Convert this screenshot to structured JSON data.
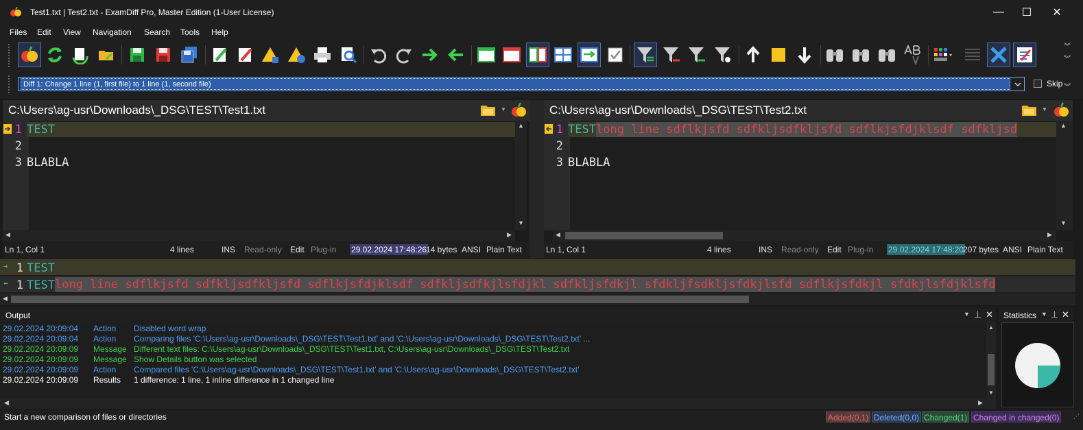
{
  "window": {
    "title": "Test1.txt  |  Test2.txt - ExamDiff Pro, Master Edition (1-User License)"
  },
  "menu": [
    "Files",
    "Edit",
    "View",
    "Navigation",
    "Search",
    "Tools",
    "Help"
  ],
  "diff_selector": {
    "value": "Diff 1: Change 1 line (1, first file) to 1 line (1, second file)"
  },
  "skip_label": "Skip",
  "left": {
    "path": "C:\\Users\\ag-usr\\Downloads\\_DSG\\TEST\\Test1.txt",
    "lines": [
      {
        "num": "1",
        "pre": "TEST",
        "post": ""
      },
      {
        "num": "2",
        "pre": "",
        "post": ""
      },
      {
        "num": "3",
        "pre": "BLABLA",
        "post": ""
      }
    ],
    "status": {
      "pos": "Ln 1, Col 1",
      "lines": "4 lines",
      "ins": "INS",
      "ro": "Read-only",
      "edit": "Edit",
      "plugin": "Plug-in",
      "date": "29.02.2024 17:48:26",
      "size": "14 bytes",
      "enc": "ANSI",
      "type": "Plain Text"
    }
  },
  "right": {
    "path": "C:\\Users\\ag-usr\\Downloads\\_DSG\\TEST\\Test2.txt",
    "lines": [
      {
        "num": "1",
        "pre": "TEST",
        "post": " long line sdflkjsfd sdfkljsdfkljsfd sdflkjsfdjklsdf sdfkljsd"
      },
      {
        "num": "2",
        "pre": "",
        "post": ""
      },
      {
        "num": "3",
        "pre": "BLABLA",
        "post": ""
      }
    ],
    "status": {
      "pos": "Ln 1, Col 1",
      "lines": "4 lines",
      "ins": "INS",
      "ro": "Read-only",
      "edit": "Edit",
      "plugin": "Plug-in",
      "date": "29.02.2024 17:48:20",
      "size": "207 bytes",
      "enc": "ANSI",
      "type": "Plain Text"
    }
  },
  "detail": {
    "line1": {
      "num": "1",
      "text": "TEST"
    },
    "line2": {
      "num": "1",
      "pre": "TEST",
      "post": " long line sdflkjsfd sdfkljsdfkljsfd sdflkjsfdjklsdf sdfkljsdfkjlsfdjkl sdfkljsfdkjl sfdkljfsdkljsfdkjlsfd sdflkjsfdkjl sfdkjlsfdjklsfd"
    }
  },
  "output": {
    "title": "Output",
    "rows": [
      {
        "time": "29.02.2024 20:09:04",
        "kind": "Action",
        "text": "Disabled word wrap",
        "color": "#4f9ef5"
      },
      {
        "time": "29.02.2024 20:09:04",
        "kind": "Action",
        "text": "Comparing files 'C:\\Users\\ag-usr\\Downloads\\_DSG\\TEST\\Test1.txt' and 'C:\\Users\\ag-usr\\Downloads\\_DSG\\TEST\\Test2.txt' ...",
        "color": "#4f9ef5"
      },
      {
        "time": "29.02.2024 20:09:09",
        "kind": "Message",
        "text": "Different text files: C:\\Users\\ag-usr\\Downloads\\_DSG\\TEST\\Test1.txt, C:\\Users\\ag-usr\\Downloads\\_DSG\\TEST\\Test2.txt",
        "color": "#3fcf4f"
      },
      {
        "time": "29.02.2024 20:09:09",
        "kind": "Message",
        "text": "Show Details button was selected",
        "color": "#3fcf4f"
      },
      {
        "time": "29.02.2024 20:09:09",
        "kind": "Action",
        "text": "Compared files 'C:\\Users\\ag-usr\\Downloads\\_DSG\\TEST\\Test1.txt' and 'C:\\Users\\ag-usr\\Downloads\\_DSG\\TEST\\Test2.txt'",
        "color": "#4f9ef5"
      },
      {
        "time": "29.02.2024 20:09:09",
        "kind": "Results",
        "text": "1 difference: 1 line, 1 inline difference in 1 changed line",
        "color": "#ffffff"
      }
    ]
  },
  "statistics": {
    "title": "Statistics",
    "changed_fraction": 0.25
  },
  "statusbar": {
    "hint": "Start a new comparison of files or directories",
    "added": "Added(0,1)",
    "deleted": "Deleted(0,0)",
    "changed": "Changed(1)",
    "changed_in_changed": "Changed in changed(0)"
  },
  "colors": {
    "accent": "#4c6fb8",
    "diff_red": "#d9454b",
    "diff_teal": "#3cb8a8",
    "line_magenta": "#e04fe0"
  }
}
